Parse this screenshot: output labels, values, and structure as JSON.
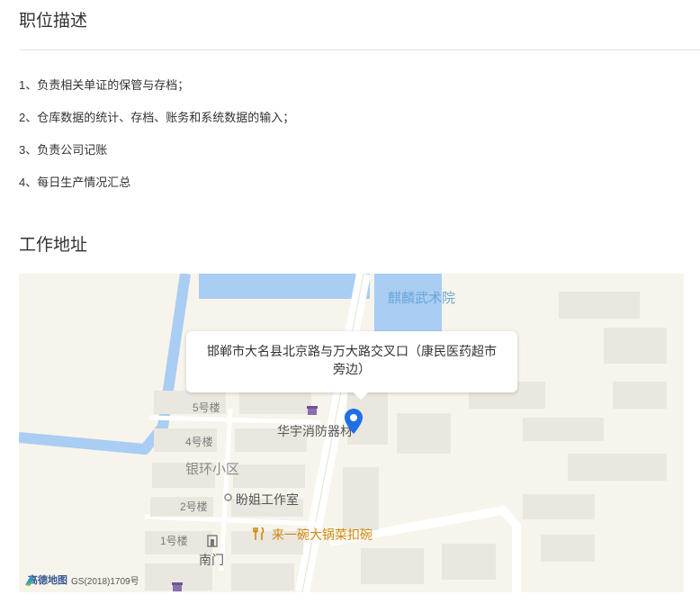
{
  "job_description": {
    "title": "职位描述",
    "items": [
      "1、负责相关单证的保管与存档；",
      "2、仓库数据的统计、存档、账务和系统数据的输入；",
      "3、负责公司记账",
      "4、每日生产情况汇总"
    ]
  },
  "work_location": {
    "title": "工作地址",
    "address": "邯郸市大名县北京路与万大路交叉口（康民医药超市旁边）"
  },
  "map": {
    "labels": {
      "martial_arts": "麒麟武术院",
      "building5": "5号楼",
      "building4": "4号楼",
      "building2": "2号楼",
      "building1": "1号楼",
      "residential": "银环小区",
      "fire_equipment": "华宇消防器材",
      "studio": "盼姐工作室",
      "restaurant": "来一碗大锅菜扣碗",
      "south_gate": "南门"
    },
    "attribution": {
      "provider": "高德地图",
      "license": "GS(2018)1709号"
    },
    "colors": {
      "land": "#f7f4ec",
      "water": "#a9cdf3",
      "road": "#ffffff",
      "building": "#eae7df",
      "pin": "#1f6fe5",
      "restaurant": "#d08a10"
    }
  }
}
